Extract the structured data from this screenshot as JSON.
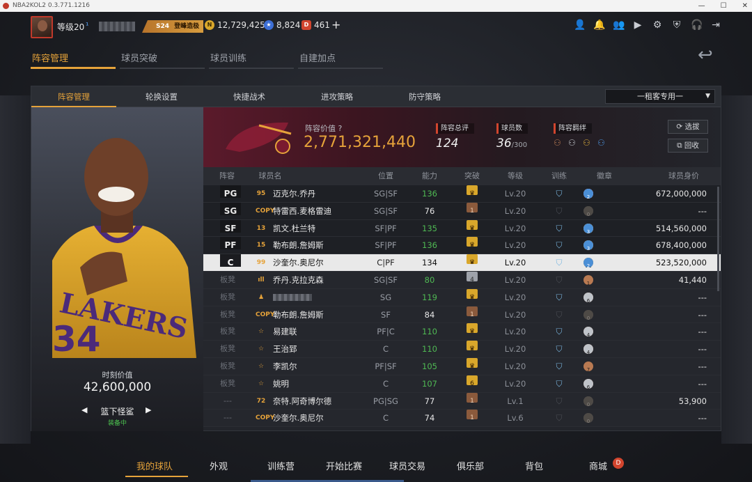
{
  "window": {
    "title": "NBA2KOL2 0.3.771.1216"
  },
  "topbar": {
    "level": "等级20",
    "level_suffix": "¹",
    "season_badge": "S24",
    "season_label": "登峰造极",
    "gold": "12,729,425",
    "stars": "8,824",
    "tickets": "461",
    "plus": "+",
    "icons": [
      "user-icon",
      "bell-icon",
      "friends-icon",
      "video-icon",
      "gear-icon",
      "shield-icon",
      "headset-icon",
      "exit-icon"
    ]
  },
  "main_tabs": [
    "阵容管理",
    "球员突破",
    "球员训练",
    "自建加点"
  ],
  "sub_tabs": [
    "阵容管理",
    "轮换设置",
    "快捷战术",
    "进攻策略",
    "防守策略"
  ],
  "dropdown": {
    "value": "一租客专用一"
  },
  "card": {
    "label": "时刻价值",
    "value": "42,600,000",
    "name": "篮下怪鲨",
    "status": "装备中"
  },
  "team": {
    "value_label": "阵容价值",
    "value": "2,771,321,440",
    "rating_label": "阵容总评",
    "rating": "124",
    "count_label": "球员数",
    "count": "36",
    "count_max": "/300",
    "bond_label": "阵容羁绊",
    "select_button": "选拔",
    "recycle_button": "回收"
  },
  "table": {
    "headers": [
      "阵容",
      "球员名",
      "位置",
      "能力",
      "突破",
      "等级",
      "训练",
      "徽章",
      "球员身价"
    ],
    "rows": [
      {
        "slot": "PG",
        "type": "starter",
        "ovr": "95",
        "name": "迈克尔.乔丹",
        "pos": "SG|SF",
        "ability": "136",
        "green": true,
        "bt": "gold",
        "btv": "♛",
        "level": "Lv.20",
        "train": "on",
        "badges": [
          [
            "b",
            "2"
          ],
          [
            "s",
            "36"
          ],
          [
            "g",
            "10"
          ],
          [
            "p",
            "4"
          ],
          [
            "d",
            "2"
          ]
        ],
        "value": "672,000,000"
      },
      {
        "slot": "SG",
        "type": "starter",
        "ovr": "COPY",
        "name": "特雷西.麦格雷迪",
        "pos": "SG|SF",
        "ability": "76",
        "green": false,
        "bt": "brown",
        "btv": "1",
        "level": "Lv.20",
        "train": "off",
        "badges": [
          [
            "x",
            "0"
          ],
          [
            "x",
            "0"
          ]
        ],
        "value": "---"
      },
      {
        "slot": "SF",
        "type": "starter",
        "ovr": "13",
        "name": "凯文.杜兰特",
        "pos": "SF|PF",
        "ability": "135",
        "green": true,
        "bt": "gold",
        "btv": "♛",
        "level": "Lv.20",
        "train": "on",
        "badges": [
          [
            "b",
            "10"
          ],
          [
            "s",
            "20"
          ],
          [
            "g",
            "9"
          ],
          [
            "d",
            "3"
          ]
        ],
        "value": "514,560,000"
      },
      {
        "slot": "PF",
        "type": "starter",
        "ovr": "15",
        "name": "勒布朗.詹姆斯",
        "pos": "SF|PF",
        "ability": "136",
        "green": true,
        "bt": "gold",
        "btv": "♛",
        "level": "Lv.20",
        "train": "on",
        "badges": [
          [
            "b",
            "19"
          ],
          [
            "s",
            "27"
          ],
          [
            "g",
            "12"
          ],
          [
            "d",
            "3"
          ]
        ],
        "value": "678,400,000"
      },
      {
        "slot": "C",
        "type": "selected",
        "ovr": "99",
        "name": "沙奎尔.奥尼尔",
        "pos": "C|PF",
        "ability": "134",
        "green": false,
        "bt": "gold",
        "btv": "♛",
        "level": "Lv.20",
        "train": "on",
        "badges": [
          [
            "b",
            "1"
          ],
          [
            "s",
            "15"
          ],
          [
            "g",
            "12"
          ],
          [
            "d",
            "2"
          ]
        ],
        "value": "523,520,000"
      },
      {
        "slot": "板凳",
        "type": "bench",
        "ovr": "ıll",
        "name": "乔丹.克拉克森",
        "pos": "SG|SF",
        "ability": "80",
        "green": true,
        "bt": "gray",
        "btv": "4",
        "level": "Lv.20",
        "train": "off",
        "badges": [
          [
            "b",
            "1"
          ]
        ],
        "value": "41,440"
      },
      {
        "slot": "板凳",
        "type": "bench",
        "ovr": "♟",
        "name": "",
        "pos": "SG",
        "ability": "119",
        "green": true,
        "bt": "gold",
        "btv": "♛",
        "level": "Lv.20",
        "train": "on",
        "badges": [
          [
            "b",
            "3"
          ],
          [
            "s",
            "6"
          ]
        ],
        "value": "---"
      },
      {
        "slot": "板凳",
        "type": "bench",
        "ovr": "COPY",
        "name": "勒布朗.詹姆斯",
        "pos": "SF",
        "ability": "84",
        "green": false,
        "bt": "brown",
        "btv": "1",
        "level": "Lv.20",
        "train": "off",
        "badges": [
          [
            "x",
            "0"
          ],
          [
            "x",
            "0"
          ]
        ],
        "value": "---"
      },
      {
        "slot": "板凳",
        "type": "bench",
        "ovr": "☆",
        "name": "易建联",
        "pos": "PF|C",
        "ability": "110",
        "green": true,
        "bt": "gold",
        "btv": "♛",
        "level": "Lv.20",
        "train": "on",
        "badges": [
          [
            "b",
            "4"
          ],
          [
            "s",
            "4"
          ]
        ],
        "value": "---"
      },
      {
        "slot": "板凳",
        "type": "bench",
        "ovr": "☆",
        "name": "王治郅",
        "pos": "C",
        "ability": "110",
        "green": true,
        "bt": "gold",
        "btv": "♛",
        "level": "Lv.20",
        "train": "on",
        "badges": [
          [
            "b",
            "6"
          ],
          [
            "s",
            "4"
          ]
        ],
        "value": "---"
      },
      {
        "slot": "板凳",
        "type": "bench",
        "ovr": "☆",
        "name": "李凯尔",
        "pos": "PF|SF",
        "ability": "105",
        "green": true,
        "bt": "gold",
        "btv": "♛",
        "level": "Lv.20",
        "train": "on",
        "badges": [
          [
            "b",
            "7"
          ]
        ],
        "value": "---"
      },
      {
        "slot": "板凳",
        "type": "bench",
        "ovr": "☆",
        "name": "姚明",
        "pos": "C",
        "ability": "107",
        "green": true,
        "bt": "gold",
        "btv": "6",
        "level": "Lv.20",
        "train": "on",
        "badges": [
          [
            "b",
            "6"
          ],
          [
            "s",
            "6"
          ]
        ],
        "value": "---"
      },
      {
        "slot": "---",
        "type": "bench",
        "ovr": "72",
        "name": "奈特.阿奇博尔德",
        "pos": "PG|SG",
        "ability": "77",
        "green": false,
        "bt": "brown",
        "btv": "1",
        "level": "Lv.1",
        "train": "off",
        "badges": [
          [
            "x",
            "0"
          ],
          [
            "x",
            "0"
          ]
        ],
        "value": "53,900"
      },
      {
        "slot": "---",
        "type": "bench",
        "ovr": "COPY",
        "name": "沙奎尔.奥尼尔",
        "pos": "C",
        "ability": "74",
        "green": false,
        "bt": "brown",
        "btv": "1",
        "level": "Lv.6",
        "train": "off",
        "badges": [
          [
            "x",
            "0"
          ],
          [
            "x",
            "0"
          ]
        ],
        "value": "---"
      }
    ]
  },
  "bottom_nav": [
    "我的球队",
    "外观",
    "训练营",
    "开始比赛",
    "球员交易",
    "俱乐部",
    "背包",
    "商城"
  ]
}
